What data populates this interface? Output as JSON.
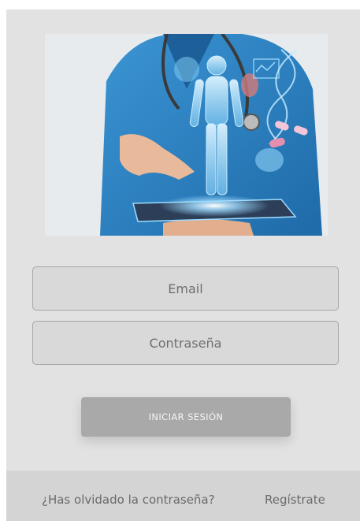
{
  "login_form": {
    "email_placeholder": "Email",
    "password_placeholder": "Contraseña",
    "submit_label": "INICIAR SESIÓN"
  },
  "footer": {
    "forgot_password": "¿Has olvidado la contraseña?",
    "register": "Regístrate"
  },
  "colors": {
    "background": "#e2e2e2",
    "footer": "#d4d4d4",
    "button": "#a9a9a9",
    "scrub_blue": "#2f86c6",
    "hologram": "#9fdcff"
  }
}
